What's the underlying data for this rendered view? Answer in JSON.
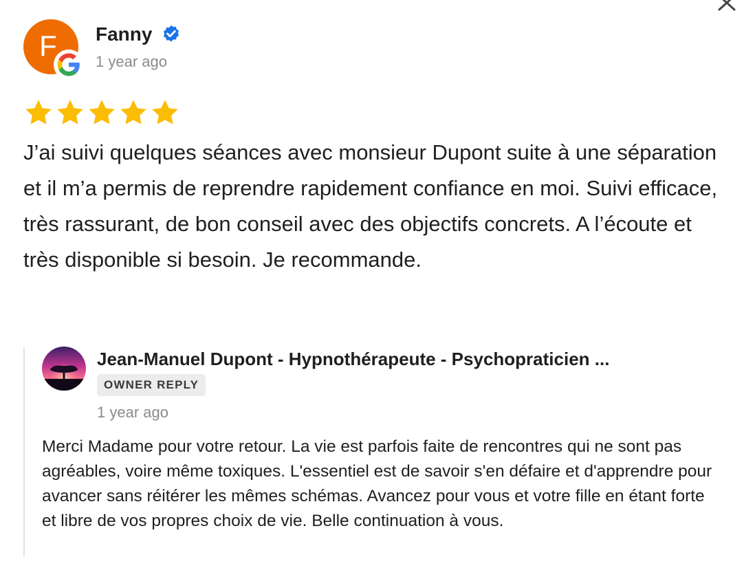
{
  "review": {
    "reviewer_name": "Fanny",
    "avatar_letter": "F",
    "avatar_color": "#ef6c00",
    "time": "1 year ago",
    "rating": 5,
    "star_color": "#fbbc04",
    "verified_icon": "verified-badge-icon",
    "source_icon": "google-g-icon",
    "text": "J’ai suivi quelques séances avec monsieur Dupont suite à une séparation et il m’a permis de reprendre rapidement confiance en moi. Suivi efficace, très rassurant, de bon conseil avec des objectifs concrets. A l’écoute et très disponible si besoin. Je recommande."
  },
  "owner_reply": {
    "owner_name": "Jean-Manuel Dupont - Hypnothérapeute - Psychopraticien ...",
    "badge": "OWNER REPLY",
    "time": "1 year ago",
    "text": "Merci Madame pour votre retour. La vie est parfois faite de rencontres qui ne sont pas agréables, voire même toxiques. L'essentiel est de savoir s'en défaire et d'apprendre pour avancer sans réitérer les mêmes schémas. Avancez pour vous et votre fille en étant forte et libre de vos propres choix de vie. Belle continuation à vous."
  },
  "controls": {
    "close_icon": "close-icon"
  }
}
